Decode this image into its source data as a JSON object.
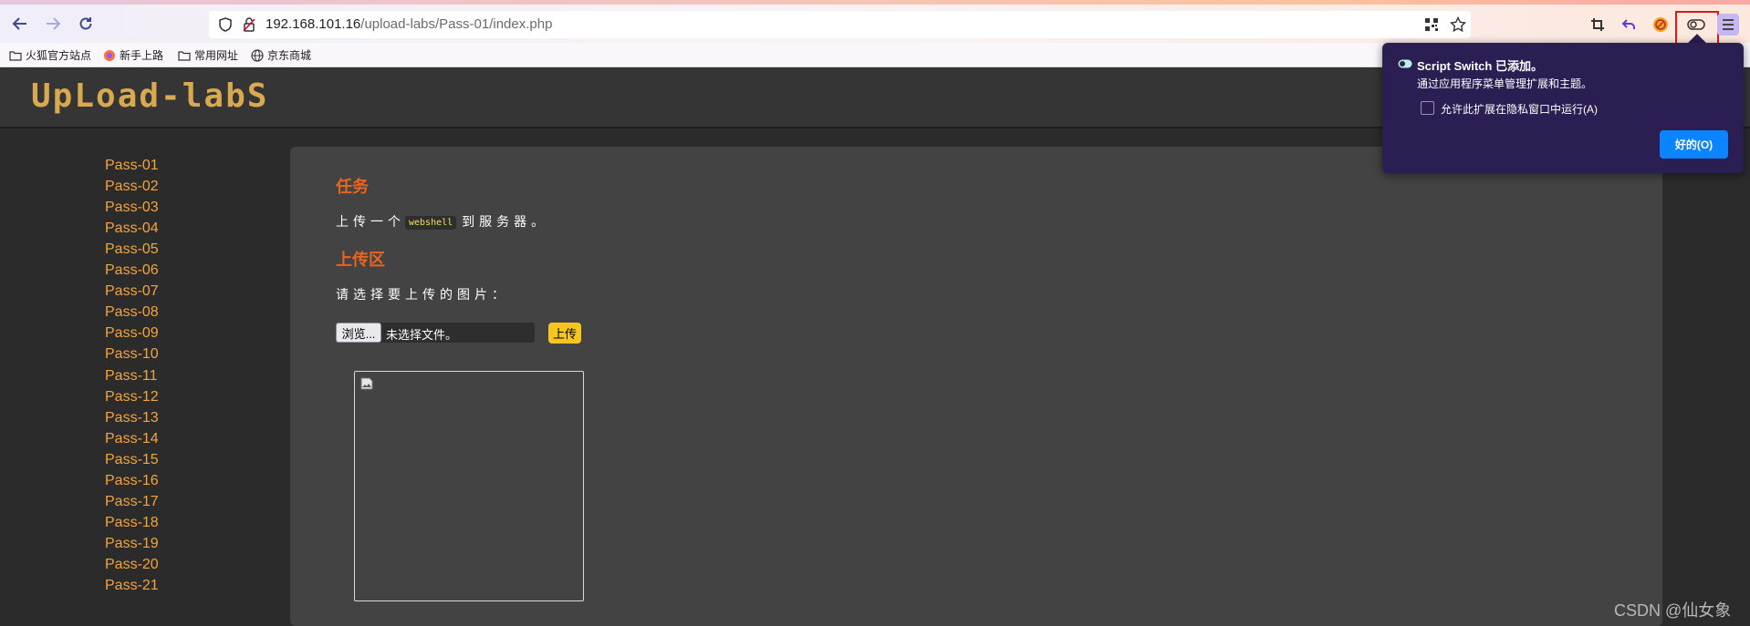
{
  "browser": {
    "url_host": "192.168.101.16",
    "url_path": "/upload-labs/Pass-01/index.php",
    "bookmarks": [
      "火狐官方站点",
      "新手上路",
      "常用网址",
      "京东商城"
    ]
  },
  "site": {
    "logo": "UpLoad-labS",
    "sidebar": [
      "Pass-01",
      "Pass-02",
      "Pass-03",
      "Pass-04",
      "Pass-05",
      "Pass-06",
      "Pass-07",
      "Pass-08",
      "Pass-09",
      "Pass-10",
      "Pass-11",
      "Pass-12",
      "Pass-13",
      "Pass-14",
      "Pass-15",
      "Pass-16",
      "Pass-17",
      "Pass-18",
      "Pass-19",
      "Pass-20",
      "Pass-21"
    ]
  },
  "content": {
    "task_title": "任务",
    "task_prefix": "上传一个",
    "task_code": "webshell",
    "task_suffix": "到服务器。",
    "upload_title": "上传区",
    "select_label": "请选择要上传的图片：",
    "browse_label": "浏览...",
    "no_file_label": "未选择文件。",
    "upload_button": "上传"
  },
  "popup": {
    "title": "Script Switch 已添加。",
    "subtitle": "通过应用程序菜单管理扩展和主题。",
    "checkbox_label": "允许此扩展在隐私窗口中运行(A)",
    "checkbox_checked": false,
    "ok_button": "好的(O)"
  },
  "watermark": "CSDN @仙女象",
  "colors": {
    "accent_orange": "#e8651f",
    "menu_link": "#f5a33e",
    "upload_button": "#f6c51e",
    "popup_bg": "#2b1e52",
    "popup_ok": "#0a84ff",
    "highlight": "#e0161b"
  }
}
